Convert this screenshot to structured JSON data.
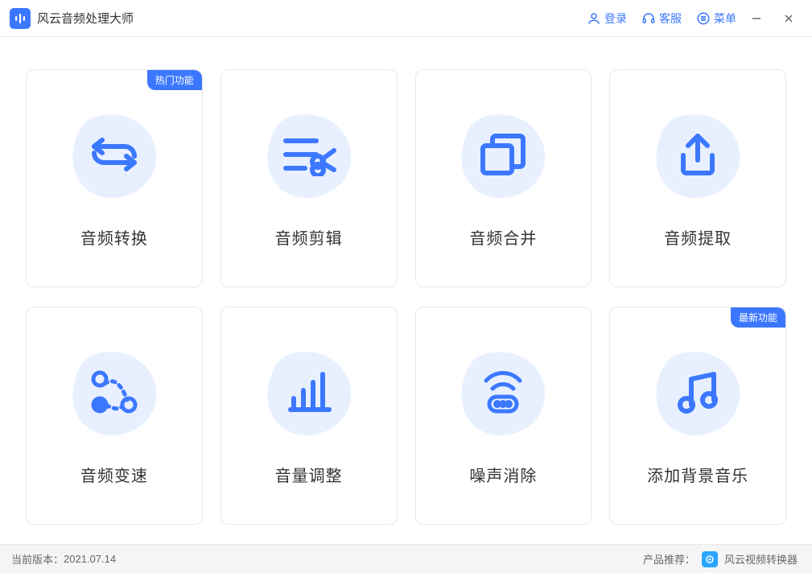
{
  "header": {
    "title": "风云音频处理大师",
    "login": "登录",
    "support": "客服",
    "menu": "菜单"
  },
  "cards": [
    {
      "label": "音频转换",
      "badge": "热门功能",
      "icon": "convert"
    },
    {
      "label": "音频剪辑",
      "badge": null,
      "icon": "cut"
    },
    {
      "label": "音频合并",
      "badge": null,
      "icon": "merge"
    },
    {
      "label": "音频提取",
      "badge": null,
      "icon": "extract"
    },
    {
      "label": "音频变速",
      "badge": null,
      "icon": "speed"
    },
    {
      "label": "音量调整",
      "badge": null,
      "icon": "volume"
    },
    {
      "label": "噪声消除",
      "badge": null,
      "icon": "denoise"
    },
    {
      "label": "添加背景音乐",
      "badge": "最新功能",
      "icon": "bgm"
    }
  ],
  "status": {
    "version_label": "当前版本：",
    "version_value": "2021.07.14",
    "recommend_label": "产品推荐：",
    "recommend_name": "风云视频转换器"
  },
  "colors": {
    "primary": "#3c78ff",
    "blob": "#e8f0ff"
  }
}
